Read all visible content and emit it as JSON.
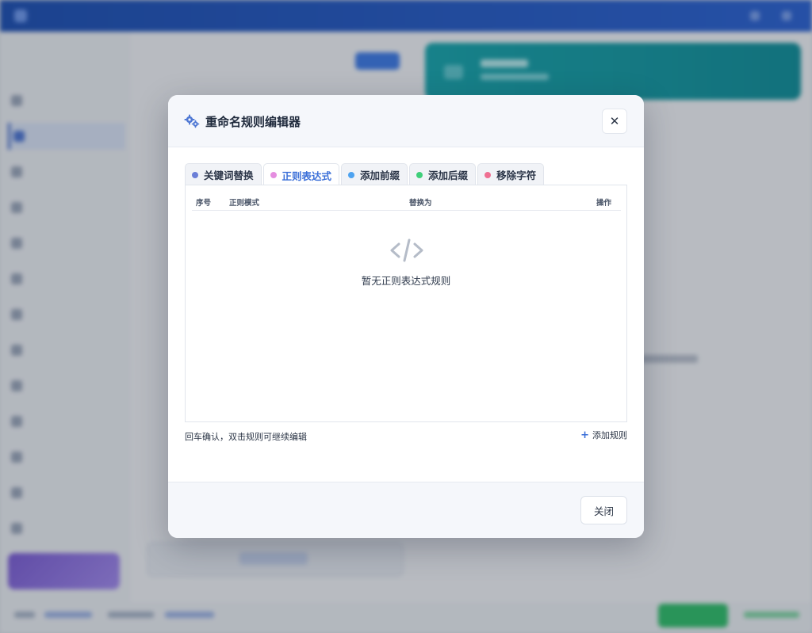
{
  "modal": {
    "title": "重命名规则编辑器",
    "close_symbol": "✕",
    "tabs": [
      {
        "label": "关键词替换",
        "dot_color": "#6b7fd7",
        "active": false
      },
      {
        "label": "正则表达式",
        "dot_color": "#e58ee0",
        "active": true
      },
      {
        "label": "添加前缀",
        "dot_color": "#4ea3f0",
        "active": false
      },
      {
        "label": "添加后缀",
        "dot_color": "#3fcf7a",
        "active": false
      },
      {
        "label": "移除字符",
        "dot_color": "#ef6f92",
        "active": false
      }
    ],
    "table": {
      "headers": [
        "序号",
        "正则模式",
        "替换为",
        "操作"
      ],
      "empty_text": "暂无正则表达式规则"
    },
    "hint": "回车确认，双击规则可继续编辑",
    "add_rule": {
      "icon": "+",
      "label": "添加规则"
    },
    "footer_close": "关闭"
  },
  "colors": {
    "accent": "#3b6fd8",
    "topbar": "#1c4fb4",
    "teal_card": "#15a6ad"
  }
}
